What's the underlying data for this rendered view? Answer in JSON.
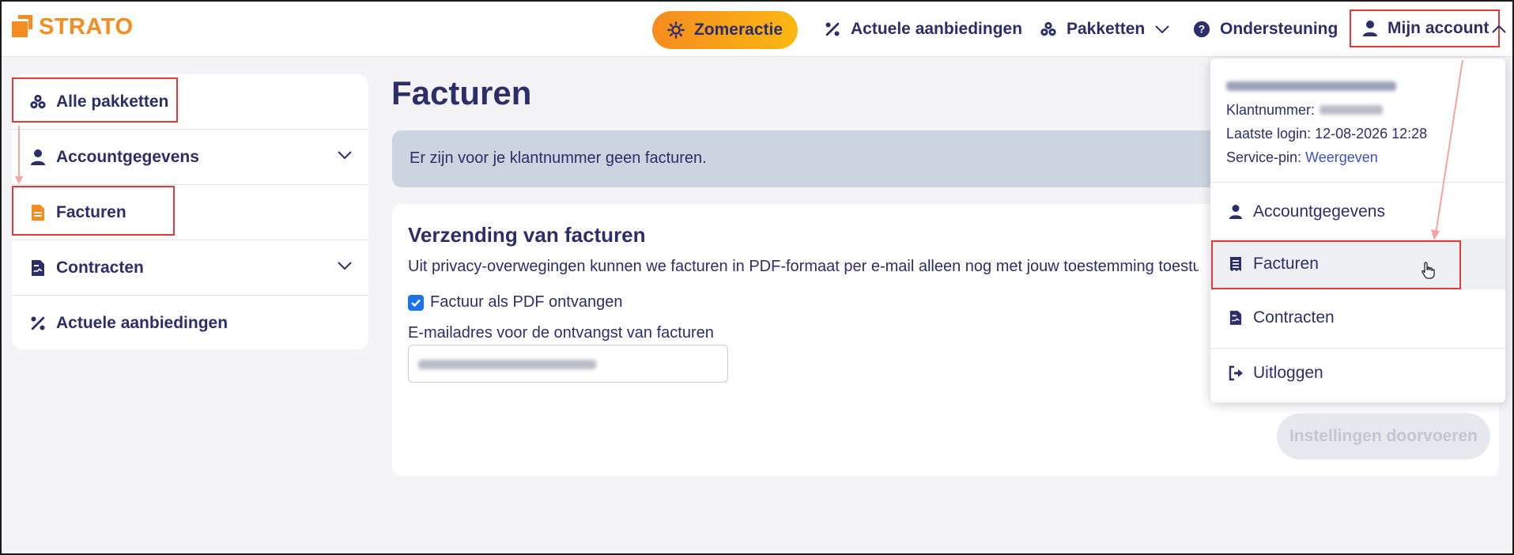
{
  "header": {
    "logo_text": "STRATO",
    "promo_label": "Zomeractie",
    "nav": [
      {
        "label": "Actuele aanbiedingen",
        "icon": "percent-icon"
      },
      {
        "label": "Pakketten",
        "icon": "packages-icon"
      },
      {
        "label": "Ondersteuning",
        "icon": "help-icon"
      }
    ],
    "account_label": "Mijn account"
  },
  "sidebar": {
    "items": [
      {
        "label": "Alle pakketten",
        "icon": "packages-icon"
      },
      {
        "label": "Accountgegevens",
        "icon": "user-icon"
      },
      {
        "label": "Facturen",
        "icon": "invoice-icon"
      },
      {
        "label": "Contracten",
        "icon": "contract-icon"
      },
      {
        "label": "Actuele aanbiedingen",
        "icon": "percent-icon"
      }
    ]
  },
  "main": {
    "title": "Facturen",
    "notice": "Er zijn voor je klantnummer geen facturen.",
    "card": {
      "title": "Verzending van facturen",
      "text": "Uit privacy-overwegingen kunnen we facturen in PDF-formaat per e-mail alleen nog met jouw toestemming toesturen.",
      "checkbox_label": "Factuur als PDF ontvangen",
      "checkbox_checked": true,
      "email_label": "E-mailadres voor de ontvangst van facturen",
      "submit_label": "Instellingen doorvoeren"
    }
  },
  "dropdown": {
    "customer_label": "Klantnummer:",
    "last_login_label": "Laatste login:",
    "last_login_value": "12-08-2026 12:28",
    "service_pin_label": "Service-pin:",
    "service_pin_link": "Weergeven",
    "items": [
      {
        "label": "Accountgegevens",
        "icon": "user-icon"
      },
      {
        "label": "Facturen",
        "icon": "invoice-icon"
      },
      {
        "label": "Contracten",
        "icon": "contract-icon"
      },
      {
        "label": "Uitloggen",
        "icon": "logout-icon"
      }
    ]
  },
  "colors": {
    "brand_orange": "#f68b1e",
    "navy": "#2c2e6a",
    "highlight_red": "#e53935",
    "link_blue": "#3b51c4"
  }
}
